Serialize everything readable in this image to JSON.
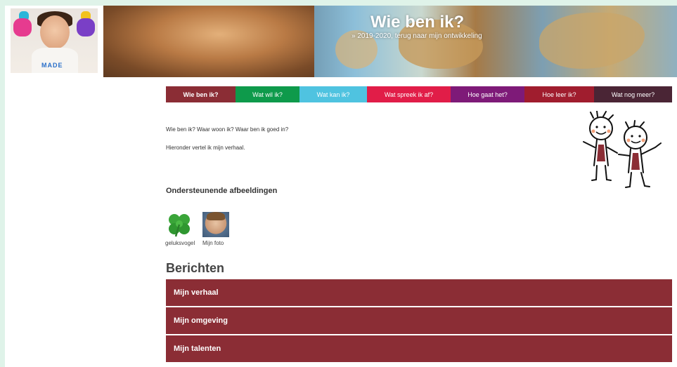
{
  "header": {
    "title": "Wie ben ik?",
    "subtitle": "» 2019-2020, terug naar mijn ontwikkeling",
    "logo_text": "MADE"
  },
  "nav": {
    "items": [
      {
        "label": "Wie ben ik?",
        "color": "#8b2d35"
      },
      {
        "label": "Wat wil ik?",
        "color": "#0e9a4b"
      },
      {
        "label": "Wat kan ik?",
        "color": "#4fc3e0"
      },
      {
        "label": "Wat spreek ik af?",
        "color": "#e11d48"
      },
      {
        "label": "Hoe gaat het?",
        "color": "#7e1a78"
      },
      {
        "label": "Hoe leer ik?",
        "color": "#a01d2e"
      },
      {
        "label": "Wat nog meer?",
        "color": "#4a2535"
      }
    ]
  },
  "content": {
    "intro_line": "Wie ben ik?  Waar woon ik? Waar ben ik goed in?",
    "story_line": "Hieronder vertel ik mijn verhaal.",
    "images_heading": "Ondersteunende afbeeldingen",
    "images": [
      {
        "label": "geluksvogel",
        "icon": "clover-icon"
      },
      {
        "label": "Mijn foto",
        "icon": "boy-photo"
      }
    ]
  },
  "berichten": {
    "heading": "Berichten",
    "items": [
      "Mijn verhaal",
      "Mijn omgeving",
      "Mijn talenten"
    ]
  },
  "colors": {
    "accordion": "#8b2d35",
    "page_background": "#dff3e9"
  }
}
